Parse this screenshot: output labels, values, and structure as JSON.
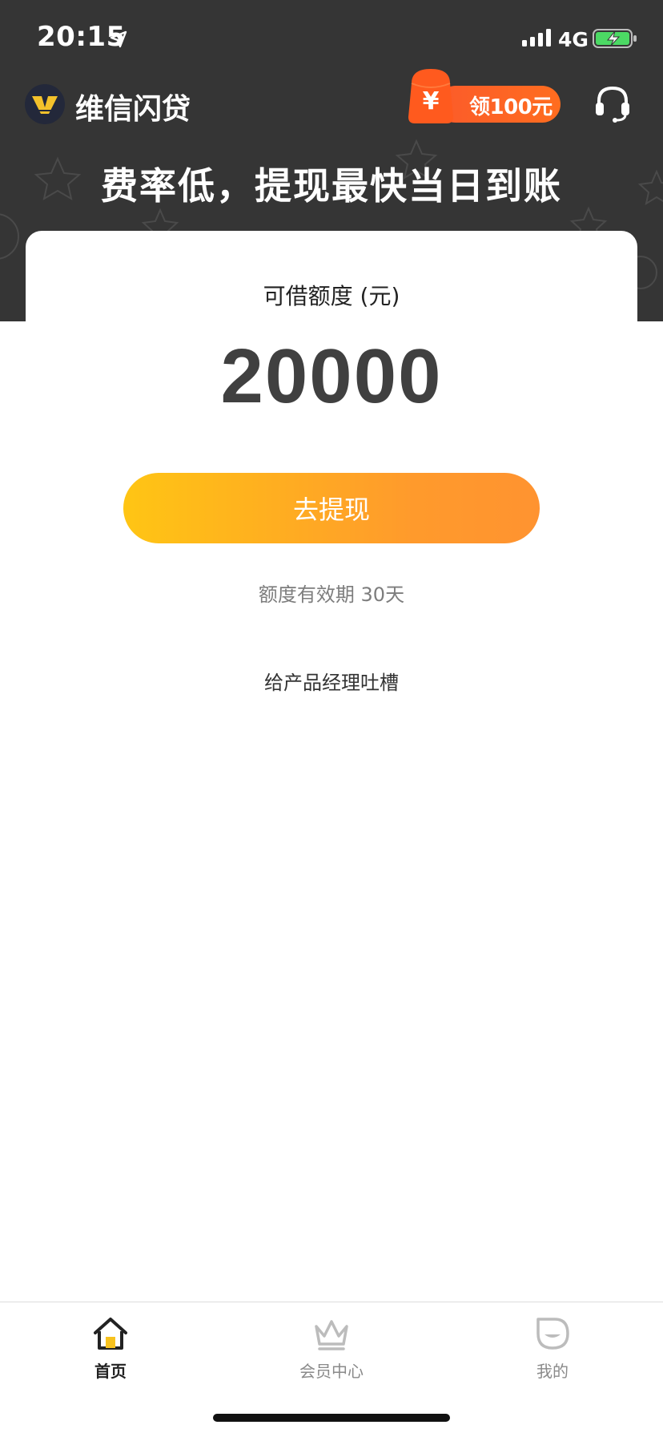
{
  "status_bar": {
    "time": "20:15",
    "network": "4G",
    "icons": [
      "location-arrow-icon",
      "signal-bars-icon",
      "battery-charging-icon"
    ]
  },
  "header": {
    "app_name": "维信闪贷",
    "promo_badge_label": "领100元",
    "promo_bag_symbol": "¥",
    "icons": [
      "app-logo-icon",
      "red-envelope-icon",
      "headset-icon"
    ]
  },
  "hero": {
    "slogan": "费率低，提现最快当日到账"
  },
  "credit_card": {
    "label": "可借额度 (元)",
    "amount": "20000",
    "withdraw_button_label": "去提现",
    "validity_text": "额度有效期 30天",
    "feedback_link_label": "给产品经理吐槽"
  },
  "tab_bar": {
    "tabs": [
      {
        "label": "首页",
        "icon": "home-icon",
        "active": true
      },
      {
        "label": "会员中心",
        "icon": "crown-icon",
        "active": false
      },
      {
        "label": "我的",
        "icon": "profile-face-icon",
        "active": false
      }
    ]
  },
  "colors": {
    "header_background": "#353535",
    "button_gradient_start": "#ffc514",
    "button_gradient_end": "#ff9330",
    "promo_orange": "#fb5b2a",
    "active_tab_text": "#222222",
    "inactive_tab_text": "#8a8a8a"
  }
}
